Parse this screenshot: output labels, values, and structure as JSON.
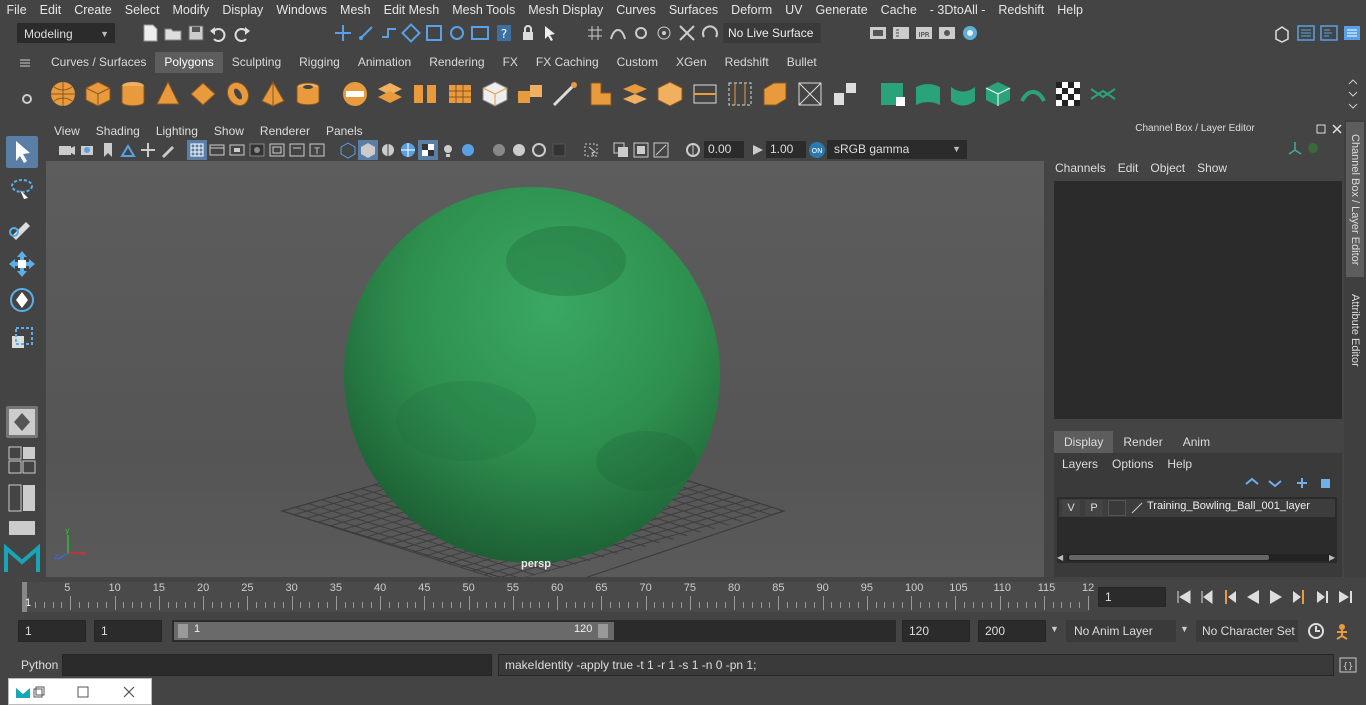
{
  "menubar": {
    "items": [
      "File",
      "Edit",
      "Create",
      "Select",
      "Modify",
      "Display",
      "Windows",
      "Mesh",
      "Edit Mesh",
      "Mesh Tools",
      "Mesh Display",
      "Curves",
      "Surfaces",
      "Deform",
      "UV",
      "Generate",
      "Cache",
      "- 3DtoAll -",
      "Redshift",
      "Help"
    ]
  },
  "statusline": {
    "workspace": "Modeling",
    "live_surface": "No Live Surface"
  },
  "shelf": {
    "tabs": [
      "Curves / Surfaces",
      "Polygons",
      "Sculpting",
      "Rigging",
      "Animation",
      "Rendering",
      "FX",
      "FX Caching",
      "Custom",
      "XGen",
      "Redshift",
      "Bullet"
    ],
    "active_tab": "Polygons"
  },
  "viewport": {
    "menus": [
      "View",
      "Shading",
      "Lighting",
      "Show",
      "Renderer",
      "Panels"
    ],
    "exposure": "0.00",
    "gamma": "1.00",
    "color_space": "sRGB gamma",
    "camera_label": "persp",
    "object_color": "#2e8f4e"
  },
  "channelbox": {
    "title": "Channel Box / Layer Editor",
    "menus": [
      "Channels",
      "Edit",
      "Object",
      "Show"
    ]
  },
  "layereditor": {
    "tabs": [
      "Display",
      "Render",
      "Anim"
    ],
    "active_tab": "Display",
    "menus": [
      "Layers",
      "Options",
      "Help"
    ],
    "layer": {
      "v": "V",
      "p": "P",
      "name": "Training_Bowling_Ball_001_layer"
    }
  },
  "sidetabs": {
    "channel_box": "Channel Box / Layer Editor",
    "attribute_editor": "Attribute Editor"
  },
  "timeline": {
    "ticks": [
      "5",
      "10",
      "15",
      "20",
      "25",
      "30",
      "35",
      "40",
      "45",
      "50",
      "55",
      "60",
      "65",
      "70",
      "75",
      "80",
      "85",
      "90",
      "95",
      "100",
      "105",
      "110",
      "115",
      "12"
    ],
    "start_label": "1",
    "current_frame": "1"
  },
  "range": {
    "start": "1",
    "playback_start": "1",
    "slider_start": "1",
    "slider_end": "120",
    "playback_end": "120",
    "end": "200",
    "anim_layer": "No Anim Layer",
    "character_set": "No Character Set"
  },
  "cmdline": {
    "language": "Python",
    "result": "makeIdentity -apply true -t 1 -r 1 -s 1 -n 0 -pn 1;"
  }
}
